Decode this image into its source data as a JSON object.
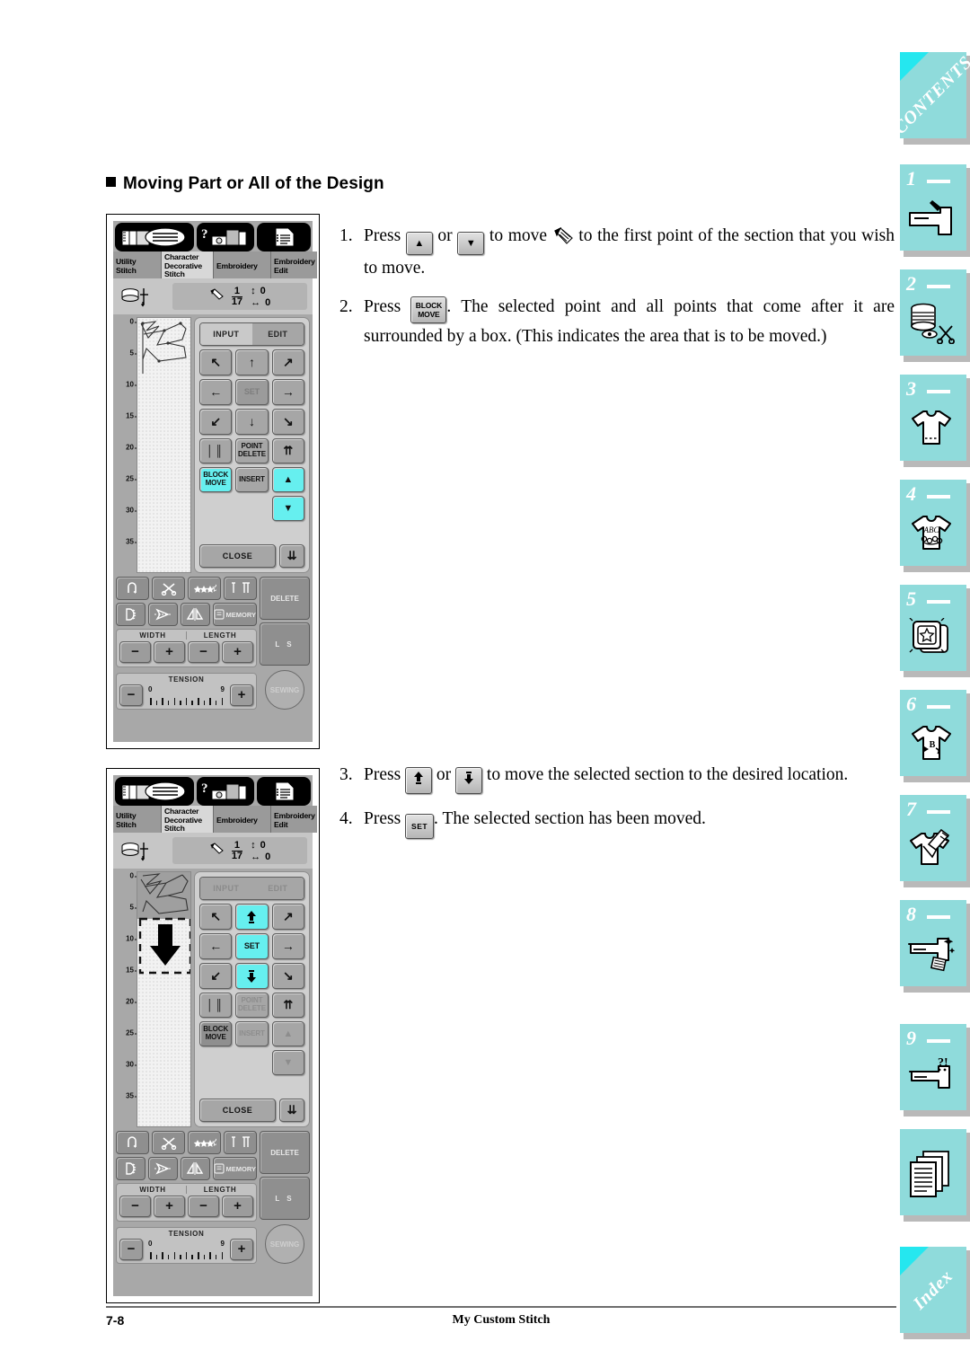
{
  "page": {
    "heading": "Moving Part or All of the Design",
    "footer_page": "7-8",
    "footer_title": "My Custom Stitch",
    "accent_cyan": "#66efef",
    "sidebar_tab_color": "#8fdbdb",
    "sidebar_corner_color": "#25e7ef"
  },
  "steps_a": [
    {
      "num": "1.",
      "parts": [
        {
          "t": "text",
          "v": "Press "
        },
        {
          "t": "key",
          "name": "up-arrow-key",
          "v": "▲"
        },
        {
          "t": "text",
          "v": " or "
        },
        {
          "t": "key",
          "name": "down-arrow-key",
          "v": "▼"
        },
        {
          "t": "text",
          "v": " to move "
        },
        {
          "t": "icon",
          "name": "pencil-cursor-icon"
        },
        {
          "t": "text",
          "v": " to the first point of the section that you wish to move."
        }
      ],
      "plain": "Press ▲ or ▼ to move (pencil) to the first point of the section that you wish to move."
    },
    {
      "num": "2.",
      "key_label": "BLOCK MOVE",
      "lead": "Press ",
      "tail": ". The selected point and all points that come after it are surrounded by a box. (This indicates the area that is to be moved.)"
    }
  ],
  "steps_b": [
    {
      "num": "3.",
      "lead": "Press ",
      "mid": " or ",
      "tail": " to move the selected section to the desired loca-tion.",
      "tail_display": " to move the selected section to the desired location.",
      "key1": "⬆",
      "key2": "⬇"
    },
    {
      "num": "4.",
      "key_label": "SET",
      "lead": "Press ",
      "tail": ". The selected section has been moved."
    }
  ],
  "lcd": {
    "icon_buttons": [
      "stitch-book-icon",
      "help-machine-icon",
      "settings-list-icon"
    ],
    "tabs": [
      {
        "label": "Utility\nStitch",
        "line1": "Utility",
        "line2": "Stitch",
        "line3": "",
        "selected": false
      },
      {
        "label": "Character Decorative Stitch",
        "line1": "Character",
        "line2": "Decorative",
        "line3": "Stitch",
        "selected": true
      },
      {
        "label": "Embroidery",
        "line1": "Embroidery",
        "line2": "",
        "line3": "",
        "selected": false
      },
      {
        "label": "Embroidery Edit",
        "line1": "Embroidery",
        "line2": "Edit",
        "line3": "",
        "selected": false
      }
    ],
    "status": {
      "point_current": "1",
      "point_total": "17",
      "vertical_value": "0",
      "horizontal_value": "0"
    },
    "ruler_ticks": [
      "0",
      "5",
      "10",
      "15",
      "20",
      "25",
      "30",
      "35"
    ],
    "pad": {
      "input_label": "INPUT",
      "edit_label": "EDIT",
      "set_label": "SET",
      "point_delete_label": "POINT DELETE",
      "point_delete_l1": "POINT",
      "point_delete_l2": "DELETE",
      "block_move_label": "BLOCK MOVE",
      "block_move_l1": "BLOCK",
      "block_move_l2": "MOVE",
      "insert_label": "INSERT",
      "close_label": "CLOSE",
      "arrows": [
        "↖",
        "↑",
        "↗",
        "←",
        "→",
        "↙",
        "↓",
        "↘"
      ],
      "jump_first": "⇈",
      "jump_last": "⇊",
      "step_up": "▲",
      "step_down": "▼"
    },
    "lower_keys": {
      "row1": [
        "reverse-stitch-icon",
        "thread-cutter-icon",
        "stitch-select-icon",
        "needle-position-icon"
      ],
      "row2": [
        "needle-mode-icon",
        "auto-threading-icon",
        "mirror-image-icon",
        "memory-icon"
      ],
      "memory_label": "MEMORY",
      "width_label": "WIDTH",
      "length_label": "LENGTH",
      "tension_label": "TENSION",
      "tension_min": "0",
      "tension_max": "9",
      "minus_label": "−",
      "plus_label": "+",
      "delete_label": "DELETE",
      "ls_label": "L   S",
      "sewing_label": "SEWING"
    }
  },
  "lcd_panel_1": {
    "highlighted_buttons": [
      "BLOCK MOVE",
      "step-up",
      "step-down"
    ],
    "selection_box": false
  },
  "lcd_panel_2": {
    "highlighted_buttons": [
      "up-arrow",
      "SET",
      "down-arrow"
    ],
    "selection_box": true
  },
  "sidebar": [
    {
      "kind": "contents",
      "label": "CONTENTS",
      "icon": "contents-tab"
    },
    {
      "kind": "num",
      "num": "1",
      "icon": "sewing-machine-icon"
    },
    {
      "kind": "num",
      "num": "2",
      "icon": "spool-scissors-icon"
    },
    {
      "kind": "num",
      "num": "3",
      "icon": "tshirt-hem-icon"
    },
    {
      "kind": "num",
      "num": "4",
      "icon": "tshirt-abc-icon"
    },
    {
      "kind": "num",
      "num": "5",
      "icon": "embroidery-hoop-star-icon"
    },
    {
      "kind": "num",
      "num": "6",
      "icon": "tshirt-letter-b-icon"
    },
    {
      "kind": "num",
      "num": "7",
      "icon": "tshirt-pen-icon"
    },
    {
      "kind": "num",
      "num": "8",
      "icon": "machine-sparkle-icon"
    },
    {
      "kind": "num",
      "num": "9",
      "icon": "machine-question-icon"
    },
    {
      "kind": "plain",
      "icon": "appendix-pages-icon"
    },
    {
      "kind": "index",
      "label": "Index",
      "icon": "index-tab"
    }
  ]
}
